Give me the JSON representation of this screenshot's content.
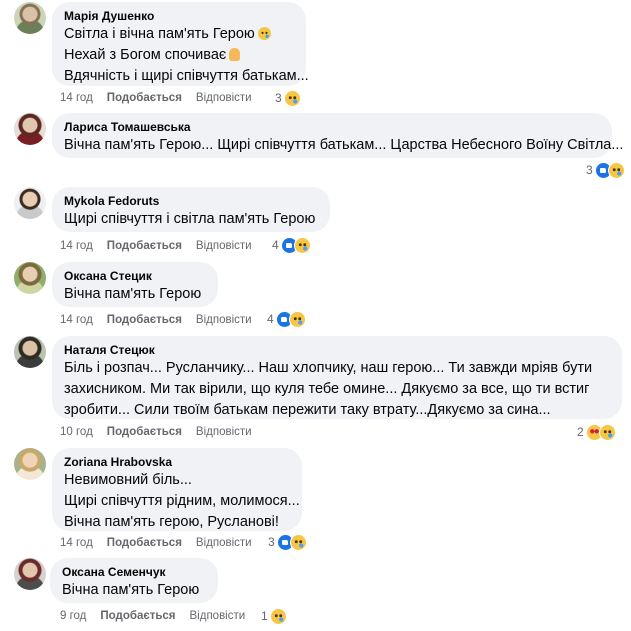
{
  "comments": [
    {
      "author": "Марія Душенко",
      "lines": [
        "Світла і вічна пам'ять Герою",
        "Нехай з Богом спочиває",
        "Вдячність і щирі співчуття батькам..."
      ],
      "inline_emojis": [
        "crying-face",
        "folded-hands"
      ],
      "time": "14 год",
      "like": "Подобається",
      "reply": "Відповісти",
      "reaction_count": "3",
      "reactions": [
        "sad"
      ]
    },
    {
      "author": "Лариса Томашевська",
      "lines": [
        "Вічна пам'ять Герою... Щирі співчуття батькам... Царства Небесного Воїну Світла..."
      ],
      "time": "",
      "like": "",
      "reply": "",
      "reaction_count": "3",
      "reactions": [
        "like",
        "sad"
      ]
    },
    {
      "author": "Mykola Fedoruts",
      "lines": [
        "Щирі співчуття і світла пам'ять Герою"
      ],
      "time": "14 год",
      "like": "Подобається",
      "reply": "Відповісти",
      "reaction_count": "4",
      "reactions": [
        "like",
        "sad"
      ]
    },
    {
      "author": "Оксана Стецик",
      "lines": [
        "Вічна пам'ять Герою"
      ],
      "time": "14 год",
      "like": "Подобається",
      "reply": "Відповісти",
      "reaction_count": "4",
      "reactions": [
        "like",
        "sad"
      ]
    },
    {
      "author": "Наталя Стецюк",
      "lines": [
        "Біль і розпач... Русланчику... Наш хлопчику, наш герою... Ти завжди мріяв бути",
        "захисником. Ми так вірили, що куля тебе омине... Дякуємо за все, що ти встиг",
        "зробити... Сили твоїм батькам пережити таку втрату...Дякуємо за сина..."
      ],
      "time": "10 год",
      "like": "Подобається",
      "reply": "Відповісти",
      "reaction_count": "2",
      "reactions": [
        "love",
        "sad"
      ]
    },
    {
      "author": "Zoriana Hrabovska",
      "lines": [
        "Невимовний біль...",
        "Щирі співчуття рідним, молимося...",
        "Вічна пам'ять герою, Русланові!"
      ],
      "time": "14 год",
      "like": "Подобається",
      "reply": "Відповісти",
      "reaction_count": "3",
      "reactions": [
        "like",
        "sad"
      ]
    },
    {
      "author": "Оксана Семенчук",
      "lines": [
        "Вічна пам'ять Герою"
      ],
      "time": "9 год",
      "like": "Подобається",
      "reply": "Відповісти",
      "reaction_count": "1",
      "reactions": [
        "sad"
      ]
    }
  ]
}
